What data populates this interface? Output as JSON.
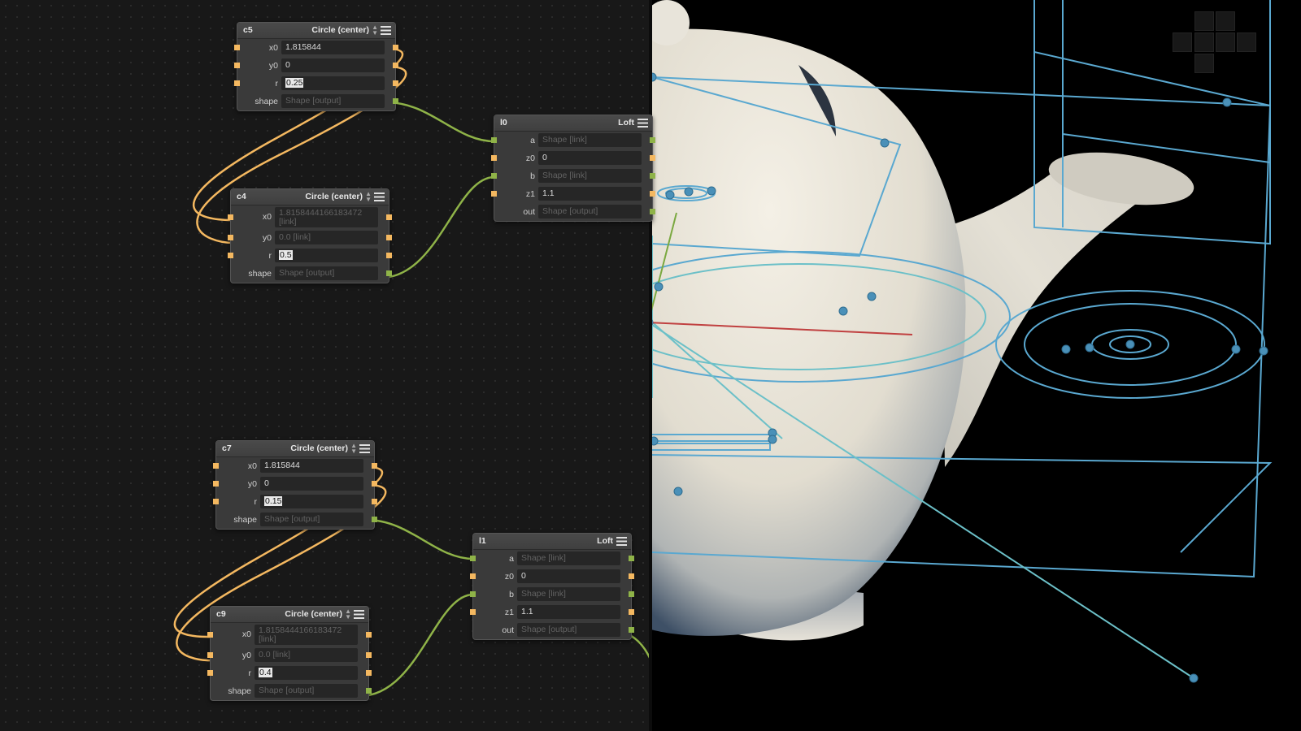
{
  "nodes": {
    "c5": {
      "id": "c5",
      "type": "Circle (center)",
      "rows": [
        {
          "label": "x0",
          "value": "1.815844"
        },
        {
          "label": "y0",
          "value": "0"
        },
        {
          "label": "r",
          "value": "0.25"
        },
        {
          "label": "shape",
          "value": "Shape [output]"
        }
      ]
    },
    "c4": {
      "id": "c4",
      "type": "Circle (center)",
      "rows": [
        {
          "label": "x0",
          "value": "1.8158444166183472 [link]"
        },
        {
          "label": "y0",
          "value": "0.0 [link]"
        },
        {
          "label": "r",
          "value": "0.5"
        },
        {
          "label": "shape",
          "value": "Shape [output]"
        }
      ]
    },
    "l0": {
      "id": "l0",
      "type": "Loft",
      "rows": [
        {
          "label": "a",
          "value": "Shape [link]"
        },
        {
          "label": "z0",
          "value": "0"
        },
        {
          "label": "b",
          "value": "Shape [link]"
        },
        {
          "label": "z1",
          "value": "1.1"
        },
        {
          "label": "out",
          "value": "Shape [output]"
        }
      ]
    },
    "c7": {
      "id": "c7",
      "type": "Circle (center)",
      "rows": [
        {
          "label": "x0",
          "value": "1.815844"
        },
        {
          "label": "y0",
          "value": "0"
        },
        {
          "label": "r",
          "value": "0.15"
        },
        {
          "label": "shape",
          "value": "Shape [output]"
        }
      ]
    },
    "c9": {
      "id": "c9",
      "type": "Circle (center)",
      "rows": [
        {
          "label": "x0",
          "value": "1.8158444166183472 [link]"
        },
        {
          "label": "y0",
          "value": "0.0 [link]"
        },
        {
          "label": "r",
          "value": "0.4"
        },
        {
          "label": "shape",
          "value": "Shape [output]"
        }
      ]
    },
    "l1": {
      "id": "l1",
      "type": "Loft",
      "rows": [
        {
          "label": "a",
          "value": "Shape [link]"
        },
        {
          "label": "z0",
          "value": "0"
        },
        {
          "label": "b",
          "value": "Shape [link]"
        },
        {
          "label": "z1",
          "value": "1.1"
        },
        {
          "label": "out",
          "value": "Shape [output]"
        }
      ]
    }
  },
  "colors": {
    "wire_number": "#f4b860",
    "wire_shape": "#8fb348",
    "node_bg": "#3a3a3a",
    "graph_bg": "#181818",
    "teapot": "#e9e4d8",
    "guide_blue": "#5aa8d0",
    "guide_teal": "#6cc0c8",
    "axis_red": "#c04040",
    "axis_green": "#7aa840"
  },
  "icons": [
    "menu-icon",
    "sort-arrows-icon",
    "input-port-icon",
    "output-port-icon",
    "nav-cube-icon"
  ]
}
